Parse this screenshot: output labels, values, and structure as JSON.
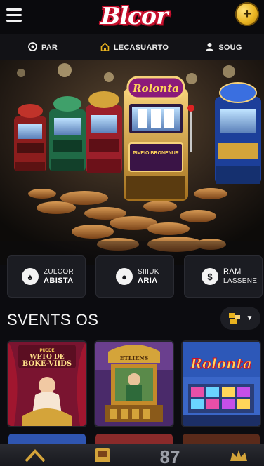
{
  "header": {
    "logo_text": "Blcor",
    "coin_symbol": "+"
  },
  "nav": {
    "items": [
      {
        "label": "PAR",
        "icon": "shield-icon"
      },
      {
        "label": "LECASUARTO",
        "icon": "home-icon"
      },
      {
        "label": "SOUG",
        "icon": "user-icon"
      }
    ]
  },
  "hero": {
    "machine_sign": "Rolonta",
    "machine_panel": "PIVEIO BRONENUR"
  },
  "quick_actions": [
    {
      "line1": "ZULCOR",
      "line2": "ABISTA",
      "icon_glyph": "♠"
    },
    {
      "line1": "SIIIUK",
      "line2": "ARIA",
      "icon_glyph": "●"
    },
    {
      "line1": "RAM",
      "line2": "LASSENE",
      "icon_glyph": "$"
    }
  ],
  "section": {
    "title": "SVENTS OS"
  },
  "games": [
    {
      "title_small": "PUDDE",
      "title": "BOKE-VIIDS",
      "subtitle": "WETO DE"
    },
    {
      "title": "ETLIENS",
      "subtitle": ""
    },
    {
      "title": "Rolonta",
      "subtitle": ""
    }
  ],
  "bottom_nav": {
    "number": "87"
  },
  "colors": {
    "accent_gold": "#e8b21f",
    "logo_red": "#c8102e",
    "background": "#0c0c10",
    "card": "#1b1c22"
  }
}
